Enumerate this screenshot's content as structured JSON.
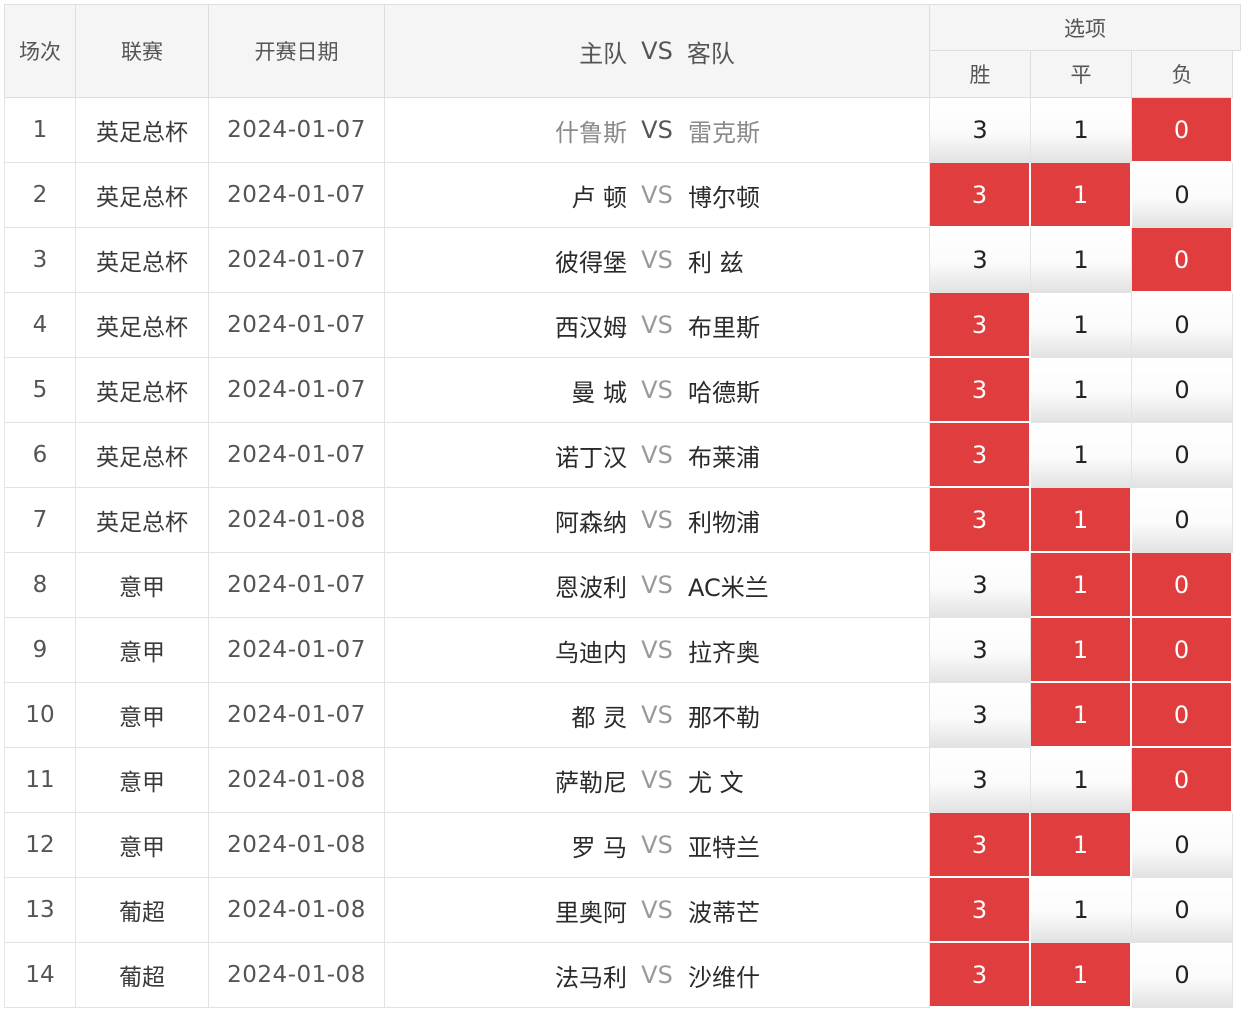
{
  "header": {
    "round": "场次",
    "league": "联赛",
    "date": "开赛日期",
    "home": "主队",
    "vs": "VS",
    "away": "客队",
    "options": "选项",
    "win": "胜",
    "draw": "平",
    "lose": "负"
  },
  "colors": {
    "selected": "#e03e3e",
    "header_bg": "#f5f5f5",
    "grid": "#e3e3e3"
  },
  "matches": [
    {
      "no": "1",
      "league": "英足总杯",
      "date": "2024-01-07",
      "home": "什鲁斯",
      "away": "雷克斯",
      "opts": [
        "3",
        "1",
        "0"
      ],
      "sel": [
        false,
        false,
        true
      ],
      "dimmed": true
    },
    {
      "no": "2",
      "league": "英足总杯",
      "date": "2024-01-07",
      "home": "卢 顿",
      "away": "博尔顿",
      "opts": [
        "3",
        "1",
        "0"
      ],
      "sel": [
        true,
        true,
        false
      ]
    },
    {
      "no": "3",
      "league": "英足总杯",
      "date": "2024-01-07",
      "home": "彼得堡",
      "away": "利 兹",
      "opts": [
        "3",
        "1",
        "0"
      ],
      "sel": [
        false,
        false,
        true
      ]
    },
    {
      "no": "4",
      "league": "英足总杯",
      "date": "2024-01-07",
      "home": "西汉姆",
      "away": "布里斯",
      "opts": [
        "3",
        "1",
        "0"
      ],
      "sel": [
        true,
        false,
        false
      ]
    },
    {
      "no": "5",
      "league": "英足总杯",
      "date": "2024-01-07",
      "home": "曼 城",
      "away": "哈德斯",
      "opts": [
        "3",
        "1",
        "0"
      ],
      "sel": [
        true,
        false,
        false
      ]
    },
    {
      "no": "6",
      "league": "英足总杯",
      "date": "2024-01-07",
      "home": "诺丁汉",
      "away": "布莱浦",
      "opts": [
        "3",
        "1",
        "0"
      ],
      "sel": [
        true,
        false,
        false
      ]
    },
    {
      "no": "7",
      "league": "英足总杯",
      "date": "2024-01-08",
      "home": "阿森纳",
      "away": "利物浦",
      "opts": [
        "3",
        "1",
        "0"
      ],
      "sel": [
        true,
        true,
        false
      ]
    },
    {
      "no": "8",
      "league": "意甲",
      "date": "2024-01-07",
      "home": "恩波利",
      "away": "AC米兰",
      "opts": [
        "3",
        "1",
        "0"
      ],
      "sel": [
        false,
        true,
        true
      ]
    },
    {
      "no": "9",
      "league": "意甲",
      "date": "2024-01-07",
      "home": "乌迪内",
      "away": "拉齐奥",
      "opts": [
        "3",
        "1",
        "0"
      ],
      "sel": [
        false,
        true,
        true
      ]
    },
    {
      "no": "10",
      "league": "意甲",
      "date": "2024-01-07",
      "home": "都 灵",
      "away": "那不勒",
      "opts": [
        "3",
        "1",
        "0"
      ],
      "sel": [
        false,
        true,
        true
      ]
    },
    {
      "no": "11",
      "league": "意甲",
      "date": "2024-01-08",
      "home": "萨勒尼",
      "away": "尤 文",
      "opts": [
        "3",
        "1",
        "0"
      ],
      "sel": [
        false,
        false,
        true
      ]
    },
    {
      "no": "12",
      "league": "意甲",
      "date": "2024-01-08",
      "home": "罗 马",
      "away": "亚特兰",
      "opts": [
        "3",
        "1",
        "0"
      ],
      "sel": [
        true,
        true,
        false
      ]
    },
    {
      "no": "13",
      "league": "葡超",
      "date": "2024-01-08",
      "home": "里奥阿",
      "away": "波蒂芒",
      "opts": [
        "3",
        "1",
        "0"
      ],
      "sel": [
        true,
        false,
        false
      ]
    },
    {
      "no": "14",
      "league": "葡超",
      "date": "2024-01-08",
      "home": "法马利",
      "away": "沙维什",
      "opts": [
        "3",
        "1",
        "0"
      ],
      "sel": [
        true,
        true,
        false
      ]
    }
  ]
}
